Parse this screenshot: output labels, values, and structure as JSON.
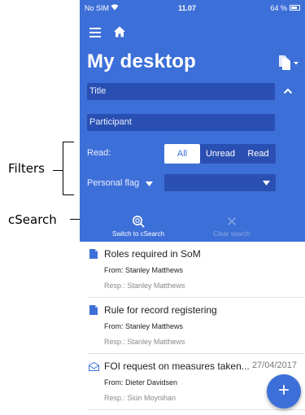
{
  "annotations": {
    "filters": "Filters",
    "csearch": "cSearch"
  },
  "status_bar": {
    "carrier": "No SIM",
    "time": "11.07",
    "battery": "64 %"
  },
  "header": {
    "title": "My desktop"
  },
  "filters": {
    "title_placeholder": "Title",
    "participant_placeholder": "Participant",
    "read_label": "Read:",
    "read_options": [
      "All",
      "Unread",
      "Read"
    ],
    "read_selected": "All",
    "personal_flag_label": "Personal flag",
    "personal_flag_value": ""
  },
  "actions": {
    "switch_csearch": "Switch to cSearch",
    "clear_search": "Clear search"
  },
  "items": [
    {
      "icon": "document-icon",
      "subject": "Roles required in SoM",
      "date": "",
      "from": "From: Stanley Matthews",
      "resp": "Resp.: Stanley Matthews"
    },
    {
      "icon": "document-icon",
      "subject": "Rule for record registering",
      "date": "",
      "from": "From: Stanley Matthews",
      "resp": "Resp.: Stanley Matthews"
    },
    {
      "icon": "email-icon",
      "subject": "FOI request on measures taken...",
      "date": "27/04/2017",
      "from": "From: Dieter Davidsen",
      "resp": "Resp.: Siún Moynihan"
    }
  ],
  "fab": {
    "label": "+"
  },
  "colors": {
    "primary": "#3d6fd8",
    "field": "#2a4fb2"
  }
}
